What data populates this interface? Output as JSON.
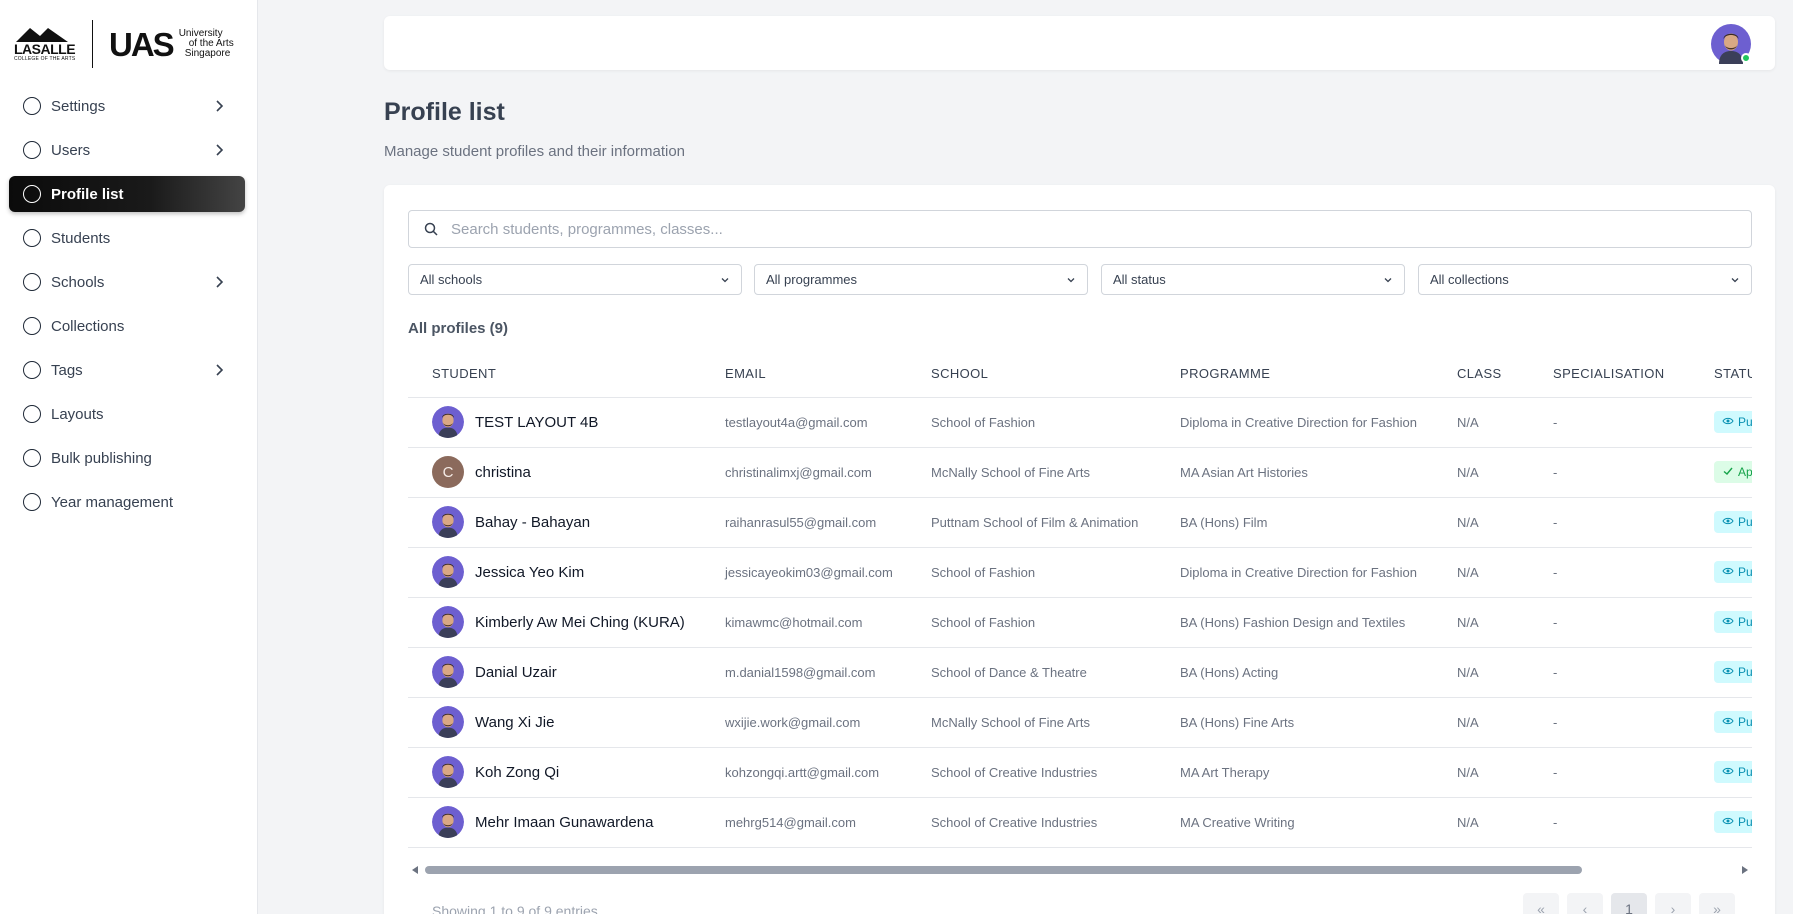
{
  "logos": {
    "lasalle_name": "LASALLE",
    "lasalle_sub": "COLLEGE OF THE ARTS",
    "uas_mark": "UAS",
    "uas_line1": "University",
    "uas_line2": "of the Arts",
    "uas_line3": "Singapore"
  },
  "sidebar": {
    "items": [
      {
        "label": "Settings",
        "has_chevron": true,
        "active": false
      },
      {
        "label": "Users",
        "has_chevron": true,
        "active": false
      },
      {
        "label": "Profile list",
        "has_chevron": false,
        "active": true
      },
      {
        "label": "Students",
        "has_chevron": false,
        "active": false
      },
      {
        "label": "Schools",
        "has_chevron": true,
        "active": false
      },
      {
        "label": "Collections",
        "has_chevron": false,
        "active": false
      },
      {
        "label": "Tags",
        "has_chevron": true,
        "active": false
      },
      {
        "label": "Layouts",
        "has_chevron": false,
        "active": false
      },
      {
        "label": "Bulk publishing",
        "has_chevron": false,
        "active": false
      },
      {
        "label": "Year management",
        "has_chevron": false,
        "active": false
      }
    ]
  },
  "header": {
    "title": "Profile list",
    "subtitle": "Manage student profiles and their information"
  },
  "search": {
    "placeholder": "Search students, programmes, classes...",
    "value": ""
  },
  "filters": {
    "schools": "All schools",
    "programmes": "All programmes",
    "status": "All status",
    "collections": "All collections"
  },
  "table": {
    "count_label": "All profiles (9)",
    "columns": {
      "student": "STUDENT",
      "email": "EMAIL",
      "school": "SCHOOL",
      "programme": "PROGRAMME",
      "class": "CLASS",
      "specialisation": "SPECIALISATION",
      "status": "STATUS"
    },
    "rows": [
      {
        "name": "TEST LAYOUT 4B",
        "email": "testlayout4a@gmail.com",
        "school": "School of Fashion",
        "programme": "Diploma in Creative Direction for Fashion",
        "class": "N/A",
        "specialisation": "-",
        "status": "Published",
        "avatar": "photo"
      },
      {
        "name": "christina",
        "email": "christinalimxj@gmail.com",
        "school": "McNally School of Fine Arts",
        "programme": "MA Asian Art Histories",
        "class": "N/A",
        "specialisation": "-",
        "status": "Approved",
        "avatar": "letter",
        "avatar_letter": "C"
      },
      {
        "name": "Bahay - Bahayan",
        "email": "raihanrasul55@gmail.com",
        "school": "Puttnam School of Film & Animation",
        "programme": "BA (Hons) Film",
        "class": "N/A",
        "specialisation": "-",
        "status": "Published",
        "avatar": "photo"
      },
      {
        "name": "Jessica Yeo Kim",
        "email": "jessicayeokim03@gmail.com",
        "school": "School of Fashion",
        "programme": "Diploma in Creative Direction for Fashion",
        "class": "N/A",
        "specialisation": "-",
        "status": "Published",
        "avatar": "photo"
      },
      {
        "name": "Kimberly Aw Mei Ching (KURA)",
        "email": "kimawmc@hotmail.com",
        "school": "School of Fashion",
        "programme": "BA (Hons) Fashion Design and Textiles",
        "class": "N/A",
        "specialisation": "-",
        "status": "Published",
        "avatar": "photo"
      },
      {
        "name": "Danial Uzair",
        "email": "m.danial1598@gmail.com",
        "school": "School of Dance & Theatre",
        "programme": "BA (Hons) Acting",
        "class": "N/A",
        "specialisation": "-",
        "status": "Published",
        "avatar": "photo"
      },
      {
        "name": "Wang Xi Jie",
        "email": "wxijie.work@gmail.com",
        "school": "McNally School of Fine Arts",
        "programme": "BA (Hons) Fine Arts",
        "class": "N/A",
        "specialisation": "-",
        "status": "Published",
        "avatar": "photo"
      },
      {
        "name": "Koh Zong Qi",
        "email": "kohzongqi.artt@gmail.com",
        "school": "School of Creative Industries",
        "programme": "MA Art Therapy",
        "class": "N/A",
        "specialisation": "-",
        "status": "Published",
        "avatar": "photo"
      },
      {
        "name": "Mehr Imaan Gunawardena",
        "email": "mehrg514@gmail.com",
        "school": "School of Creative Industries",
        "programme": "MA Creative Writing",
        "class": "N/A",
        "specialisation": "-",
        "status": "Published",
        "avatar": "photo"
      }
    ]
  },
  "footer": {
    "showing": "Showing 1 to 9 of 9 entries",
    "current_page": "1"
  },
  "colors": {
    "accent_dark": "#111111",
    "published_bg": "#cffafe",
    "published_fg": "#0891b2",
    "approved_bg": "#dcfce7",
    "approved_fg": "#16a34a",
    "online": "#22c55e"
  }
}
